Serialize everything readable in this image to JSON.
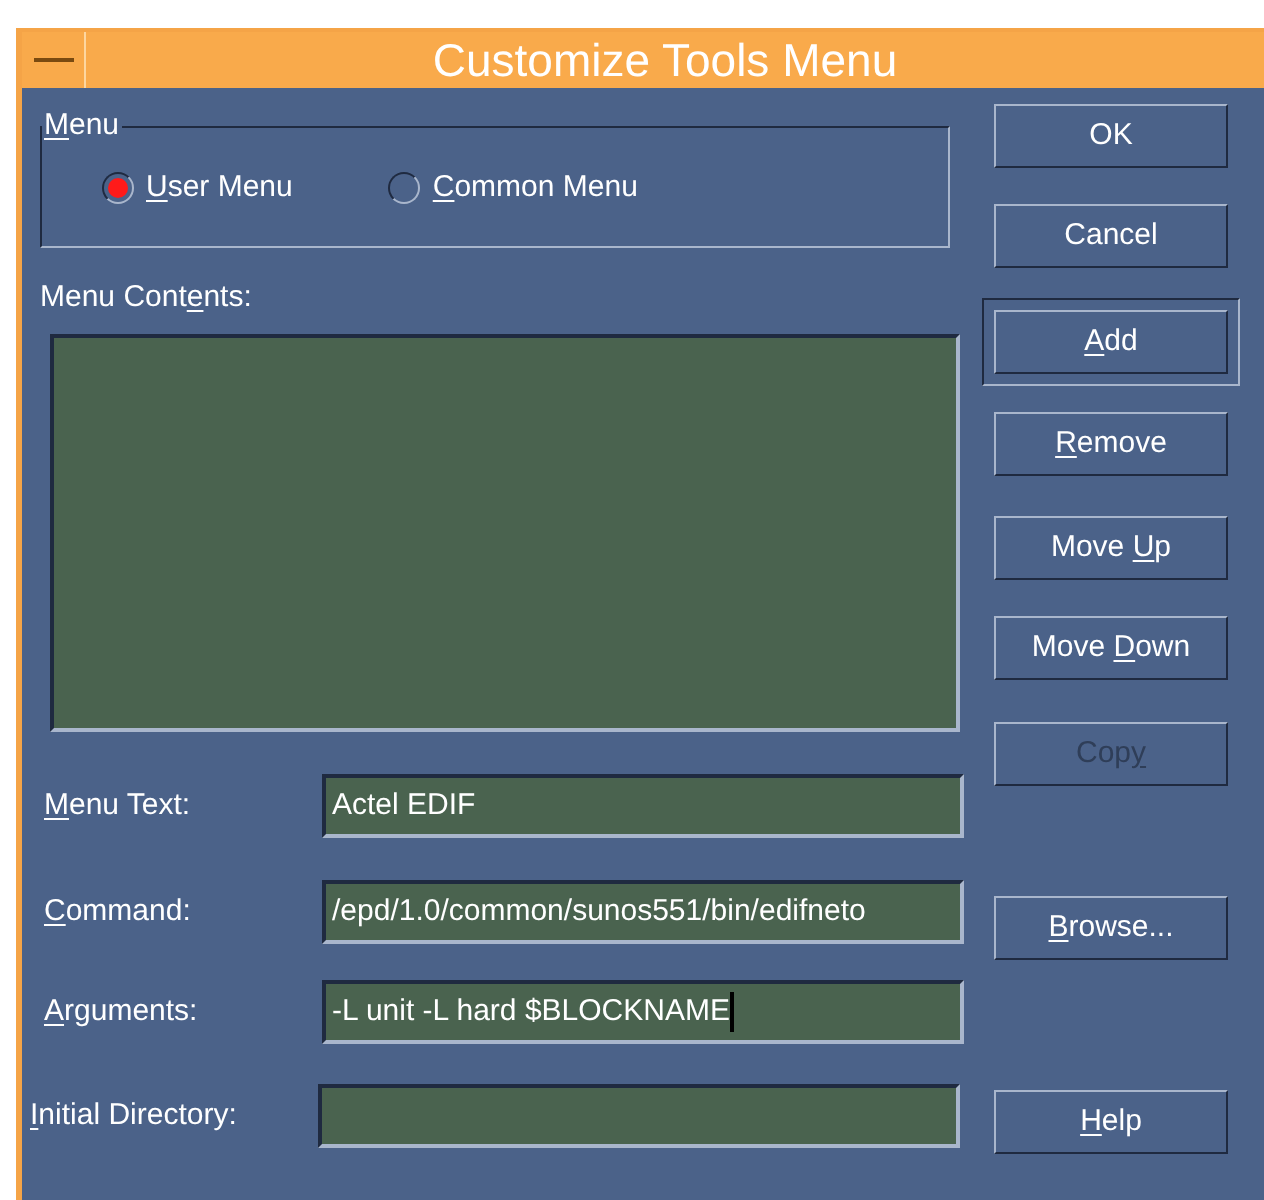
{
  "window": {
    "title": "Customize Tools Menu"
  },
  "menu_group": {
    "label": [
      {
        "text": "M",
        "underline": true
      },
      {
        "text": "enu",
        "underline": false
      }
    ],
    "options": [
      {
        "label": [
          {
            "text": "U",
            "underline": true
          },
          {
            "text": "ser Menu",
            "underline": false
          }
        ],
        "selected": true
      },
      {
        "label": [
          {
            "text": "C",
            "underline": true
          },
          {
            "text": "ommon Menu",
            "underline": false
          }
        ],
        "selected": false
      }
    ]
  },
  "menu_contents": {
    "label": [
      {
        "text": "Menu Cont",
        "underline": false
      },
      {
        "text": "e",
        "underline": true
      },
      {
        "text": "nts:",
        "underline": false
      }
    ]
  },
  "fields": [
    {
      "label": [
        {
          "text": "M",
          "underline": true
        },
        {
          "text": "enu Text:",
          "underline": false
        }
      ],
      "value": "Actel EDIF",
      "focused": false
    },
    {
      "label": [
        {
          "text": "C",
          "underline": true
        },
        {
          "text": "ommand:",
          "underline": false
        }
      ],
      "value": "/epd/1.0/common/sunos551/bin/edifneto",
      "focused": false
    },
    {
      "label": [
        {
          "text": "A",
          "underline": true
        },
        {
          "text": "rguments:",
          "underline": false
        }
      ],
      "value": "-L unit -L hard $BLOCKNAME",
      "focused": true
    },
    {
      "label": [
        {
          "text": "I",
          "underline": true
        },
        {
          "text": "nitial Directory:",
          "underline": false
        }
      ],
      "focused": false
    }
  ],
  "buttons": [
    {
      "label": [
        {
          "text": "OK",
          "underline": false
        }
      ],
      "default": false,
      "disabled": false
    },
    {
      "label": [
        {
          "text": "Cancel",
          "underline": false
        }
      ],
      "default": false,
      "disabled": false
    },
    {
      "label": [
        {
          "text": "A",
          "underline": true
        },
        {
          "text": "dd",
          "underline": false
        }
      ],
      "default": true,
      "disabled": false
    },
    {
      "label": [
        {
          "text": "R",
          "underline": true
        },
        {
          "text": "emove",
          "underline": false
        }
      ],
      "default": false,
      "disabled": false
    },
    {
      "label": [
        {
          "text": "Move ",
          "underline": false
        },
        {
          "text": "U",
          "underline": true
        },
        {
          "text": "p",
          "underline": false
        }
      ],
      "default": false,
      "disabled": false
    },
    {
      "label": [
        {
          "text": "Move ",
          "underline": false
        },
        {
          "text": "D",
          "underline": true
        },
        {
          "text": "own",
          "underline": false
        }
      ],
      "default": false,
      "disabled": false
    },
    {
      "label": [
        {
          "text": "Cop",
          "underline": false
        },
        {
          "text": "y",
          "underline": true
        }
      ],
      "default": false,
      "disabled": true
    },
    {
      "label": [
        {
          "text": "B",
          "underline": true
        },
        {
          "text": "rowse...",
          "underline": false
        }
      ],
      "default": false,
      "disabled": false
    },
    {
      "label": [
        {
          "text": "H",
          "underline": true
        },
        {
          "text": "elp",
          "underline": false
        }
      ],
      "default": false,
      "disabled": false
    }
  ]
}
